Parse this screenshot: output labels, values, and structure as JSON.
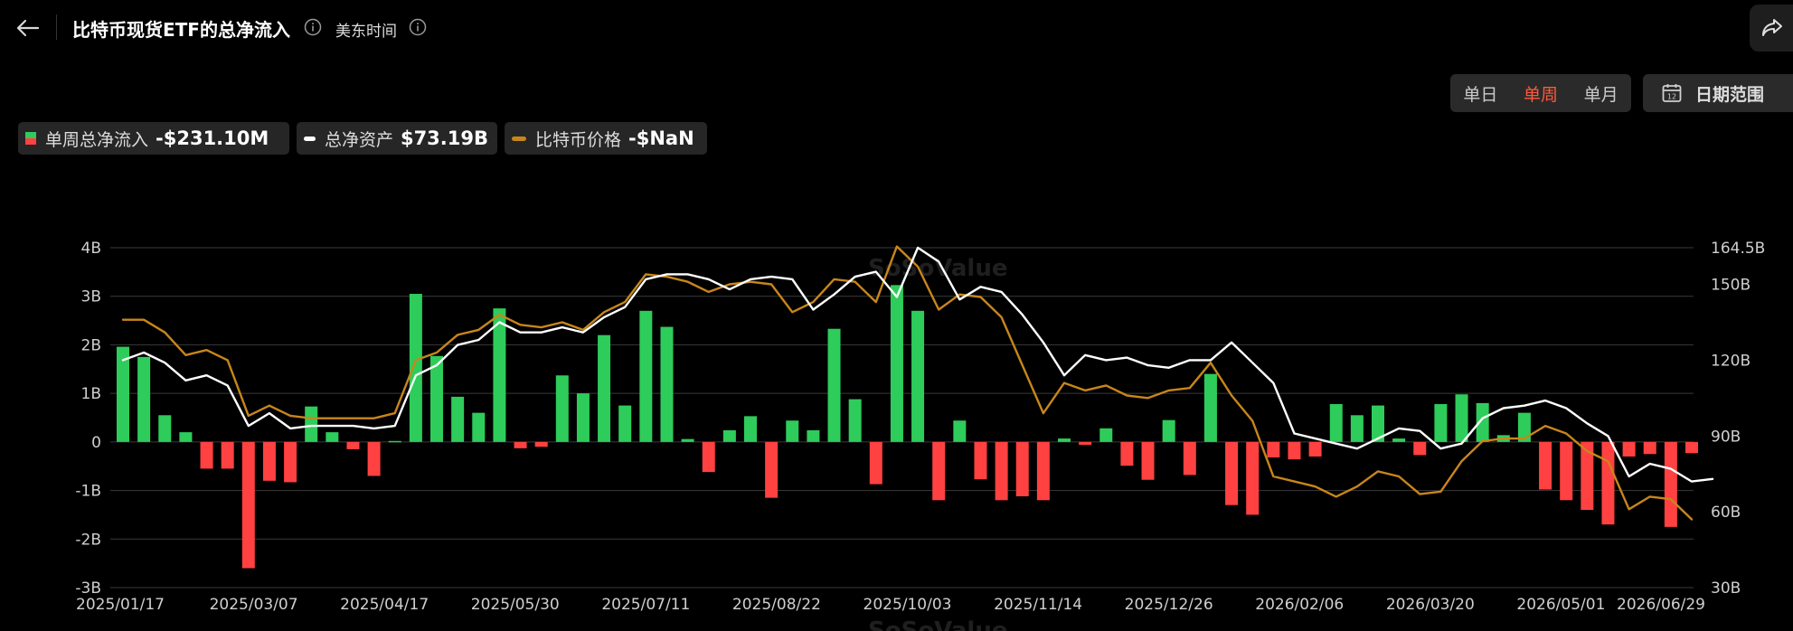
{
  "header": {
    "title": "比特币现货ETF的总净流入",
    "timezone": "美东时间"
  },
  "controls": {
    "periods": [
      "单日",
      "单周",
      "单月"
    ],
    "active_period": "单周",
    "date_range_label": "日期范围"
  },
  "legend": {
    "flow": {
      "label": "单周总净流入",
      "value": "-$231.10M"
    },
    "assets": {
      "label": "总净资产",
      "value": "$73.19B"
    },
    "price": {
      "label": "比特币价格",
      "value": "-$NaN"
    }
  },
  "watermark": "SoSoValue",
  "colors": {
    "positive": "#2ecc5a",
    "negative": "#ff4141",
    "assets_line": "#ffffff",
    "price_line": "#c8861a",
    "accent": "#ff5a3c"
  },
  "chart_data": {
    "type": "bar",
    "x_tick_labels": [
      "2025/01/17",
      "2025/03/07",
      "2025/04/17",
      "2025/05/30",
      "2025/07/11",
      "2025/08/22",
      "2025/10/03",
      "2025/11/14",
      "2025/12/26",
      "2026/02/06",
      "2026/03/20",
      "2026/05/01",
      "2026/06/29"
    ],
    "y_left": {
      "ticks": [
        "4B",
        "3B",
        "2B",
        "1B",
        "0",
        "-1B",
        "-2B",
        "-3B"
      ],
      "range": [
        -3,
        4
      ],
      "unit": "B"
    },
    "y_right": {
      "ticks": [
        "164.5B",
        "150B",
        "120B",
        "90B",
        "60B",
        "30B"
      ],
      "range": [
        30,
        164.5
      ],
      "unit": "B"
    },
    "series": [
      {
        "name": "单周总净流入",
        "type": "bar",
        "values": [
          1.96,
          1.75,
          0.55,
          0.2,
          -0.55,
          -0.55,
          -2.6,
          -0.8,
          -0.83,
          0.73,
          0.2,
          -0.15,
          -0.7,
          0.02,
          3.05,
          1.77,
          0.93,
          0.6,
          2.75,
          -0.13,
          -0.1,
          1.37,
          1.0,
          2.2,
          0.75,
          2.7,
          2.37,
          0.06,
          -0.62,
          0.24,
          0.53,
          -1.15,
          0.44,
          0.24,
          2.33,
          0.88,
          -0.87,
          3.23,
          2.7,
          -1.2,
          0.44,
          -0.77,
          -1.2,
          -1.12,
          -1.2,
          0.07,
          -0.06,
          0.28,
          -0.49,
          -0.78,
          0.45,
          -0.68,
          1.4,
          -1.3,
          -1.5,
          -0.32,
          -0.36,
          -0.3,
          0.78,
          0.55,
          0.75,
          0.07,
          -0.27,
          0.78,
          0.98,
          0.8,
          0.14,
          0.6,
          -0.98,
          -1.2,
          -1.4,
          -1.7,
          -0.3,
          -0.25,
          -1.75,
          -0.23
        ]
      },
      {
        "name": "总净资产",
        "type": "line",
        "values": [
          120,
          123,
          119,
          112,
          114,
          110,
          94,
          99,
          93,
          94,
          94,
          94,
          93,
          94,
          114,
          118,
          126,
          128,
          135,
          131,
          131,
          133,
          131,
          137,
          141,
          152,
          154,
          154,
          152,
          148,
          152,
          153,
          152,
          140,
          146,
          153,
          155,
          145,
          164.5,
          159,
          144,
          149,
          147,
          138,
          127,
          114,
          122,
          120,
          121,
          118,
          117,
          120,
          120,
          127,
          119,
          111,
          91,
          89,
          87,
          85,
          89,
          93,
          92,
          85,
          87,
          97,
          101,
          102,
          104,
          101,
          95,
          90,
          74,
          79,
          77,
          72,
          73
        ]
      },
      {
        "name": "比特币价格",
        "type": "line",
        "values": [
          136,
          136,
          131,
          122,
          124,
          120,
          98,
          102,
          98,
          97,
          97,
          97,
          97,
          99,
          120,
          123,
          130,
          132,
          138,
          134,
          133,
          135,
          132,
          139,
          143,
          154,
          153,
          151,
          147,
          150,
          151,
          150,
          139,
          143,
          152,
          151,
          143,
          165,
          157,
          140,
          146,
          145,
          137,
          118,
          99,
          111,
          108,
          110,
          106,
          105,
          108,
          109,
          119,
          106,
          96,
          74,
          72,
          70,
          66,
          70,
          76,
          74,
          67,
          68,
          80,
          88,
          89,
          89,
          94,
          91,
          84,
          80,
          61,
          66,
          65,
          57
        ]
      }
    ]
  }
}
